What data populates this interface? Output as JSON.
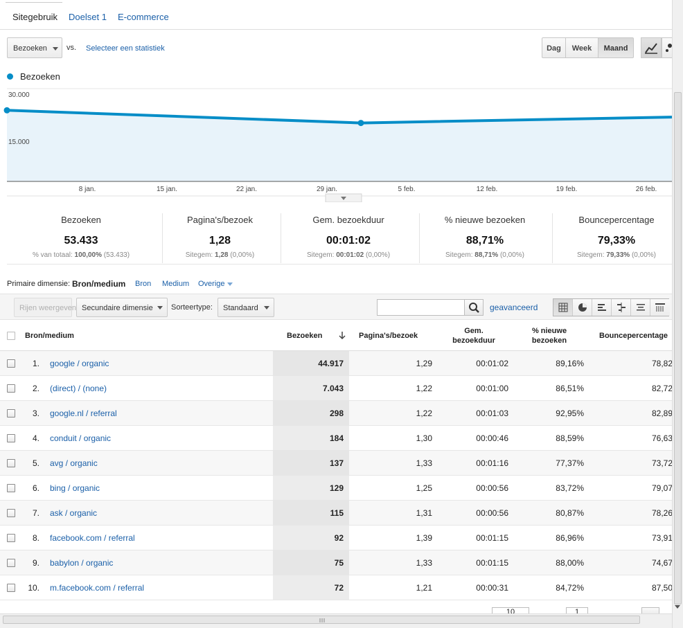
{
  "tabs": [
    {
      "label": "Sitegebruik"
    },
    {
      "label": "Doelset 1"
    },
    {
      "label": "E-commerce"
    }
  ],
  "toolbar": {
    "metric": "Bezoeken",
    "vs": "vs.",
    "select_stat": "Selecteer een statistiek",
    "period_buttons": [
      "Dag",
      "Week",
      "Maand"
    ],
    "active_period": "Maand"
  },
  "legend": {
    "label": "Bezoeken",
    "color": "#058dc7"
  },
  "chart_data": {
    "type": "area",
    "series": [
      {
        "name": "Bezoeken",
        "values": [
          23000,
          18900,
          20800
        ]
      }
    ],
    "y_ticks": [
      "30.000",
      "15.000"
    ],
    "x_ticks": [
      "8 jan.",
      "15 jan.",
      "22 jan.",
      "29 jan.",
      "5 feb.",
      "12 feb.",
      "19 feb.",
      "26 feb."
    ],
    "ylim": [
      0,
      30000
    ],
    "grid": true,
    "color": "#058dc7"
  },
  "summary": [
    {
      "label": "Bezoeken",
      "value": "53.433",
      "sub_prefix": "% van totaal:",
      "sub_bold": "100,00%",
      "sub_suffix": "(53.433)"
    },
    {
      "label": "Pagina's/bezoek",
      "value": "1,28",
      "sub_prefix": "Sitegem:",
      "sub_bold": "1,28",
      "sub_suffix": "(0,00%)"
    },
    {
      "label": "Gem. bezoekduur",
      "value": "00:01:02",
      "sub_prefix": "Sitegem:",
      "sub_bold": "00:01:02",
      "sub_suffix": "(0,00%)"
    },
    {
      "label": "% nieuwe bezoeken",
      "value": "88,71%",
      "sub_prefix": "Sitegem:",
      "sub_bold": "88,71%",
      "sub_suffix": "(0,00%)"
    },
    {
      "label": "Bouncepercentage",
      "value": "79,33%",
      "sub_prefix": "Sitegem:",
      "sub_bold": "79,33%",
      "sub_suffix": "(0,00%)"
    }
  ],
  "dimensions": {
    "label": "Primaire dimensie:",
    "active": "Bron/medium",
    "options": [
      "Bron",
      "Medium",
      "Overige"
    ]
  },
  "table_toolbar": {
    "plot_rows": "Rijen weergeven",
    "secondary_dimension": "Secundaire dimensie",
    "sort_type_label": "Sorteertype:",
    "sort_type": "Standaard",
    "search_value": "",
    "advanced": "geavanceerd"
  },
  "table": {
    "headers": {
      "dimension": "Bron/medium",
      "visits": "Bezoeken",
      "pages": "Pagina's/bezoek",
      "duration_1": "Gem.",
      "duration_2": "bezoekduur",
      "new_1": "% nieuwe",
      "new_2": "bezoeken",
      "bounce": "Bouncepercentage"
    },
    "rows": [
      {
        "n": "1.",
        "source": "google / organic",
        "visits": "44.917",
        "pages": "1,29",
        "duration": "00:01:02",
        "new": "89,16%",
        "bounce": "78,82"
      },
      {
        "n": "2.",
        "source": "(direct) / (none)",
        "visits": "7.043",
        "pages": "1,22",
        "duration": "00:01:00",
        "new": "86,51%",
        "bounce": "82,72"
      },
      {
        "n": "3.",
        "source": "google.nl / referral",
        "visits": "298",
        "pages": "1,22",
        "duration": "00:01:03",
        "new": "92,95%",
        "bounce": "82,89"
      },
      {
        "n": "4.",
        "source": "conduit / organic",
        "visits": "184",
        "pages": "1,30",
        "duration": "00:00:46",
        "new": "88,59%",
        "bounce": "76,63"
      },
      {
        "n": "5.",
        "source": "avg / organic",
        "visits": "137",
        "pages": "1,33",
        "duration": "00:01:16",
        "new": "77,37%",
        "bounce": "73,72"
      },
      {
        "n": "6.",
        "source": "bing / organic",
        "visits": "129",
        "pages": "1,25",
        "duration": "00:00:56",
        "new": "83,72%",
        "bounce": "79,07"
      },
      {
        "n": "7.",
        "source": "ask / organic",
        "visits": "115",
        "pages": "1,31",
        "duration": "00:00:56",
        "new": "80,87%",
        "bounce": "78,26"
      },
      {
        "n": "8.",
        "source": "facebook.com / referral",
        "visits": "92",
        "pages": "1,39",
        "duration": "00:01:15",
        "new": "86,96%",
        "bounce": "73,91"
      },
      {
        "n": "9.",
        "source": "babylon / organic",
        "visits": "75",
        "pages": "1,33",
        "duration": "00:01:15",
        "new": "88,00%",
        "bounce": "74,67"
      },
      {
        "n": "10.",
        "source": "m.facebook.com / referral",
        "visits": "72",
        "pages": "1,21",
        "duration": "00:00:31",
        "new": "84,72%",
        "bounce": "87,50"
      }
    ]
  },
  "pager": {
    "rows_value": "10",
    "page_value": "1"
  }
}
